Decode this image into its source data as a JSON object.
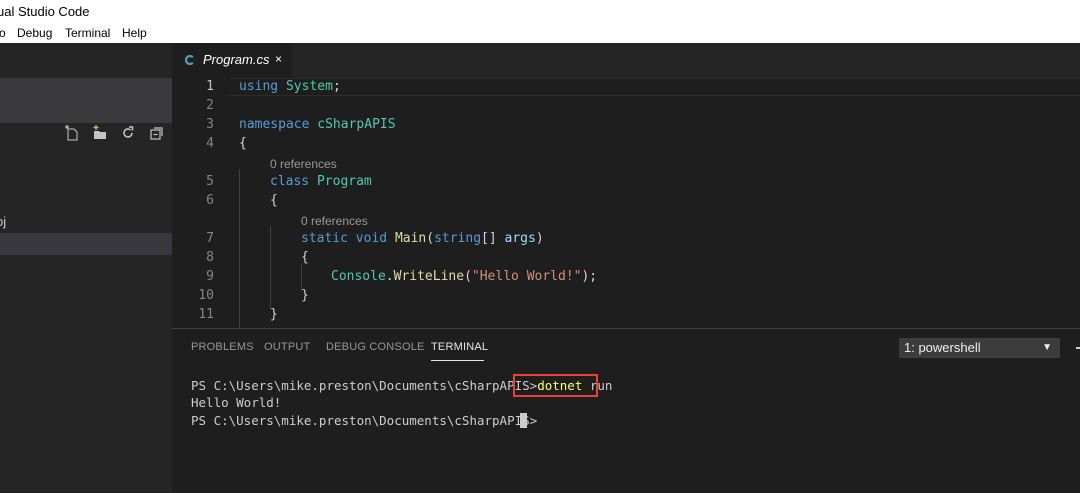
{
  "window": {
    "title": "ual Studio Code"
  },
  "menu": {
    "items": [
      "o",
      "Debug",
      "Terminal",
      "Help"
    ]
  },
  "sidebar": {
    "items": [
      "oj"
    ]
  },
  "tab": {
    "label": "Program.cs",
    "close": "×"
  },
  "editor": {
    "line_numbers": [
      "1",
      "2",
      "3",
      "4",
      "5",
      "6",
      "7",
      "8",
      "9",
      "10",
      "11"
    ],
    "lens": "0 references",
    "tokens": {
      "using": "using",
      "system": "System",
      "semi": ";",
      "namespace": "namespace",
      "ns_name": "cSharpAPIS",
      "open_brace": "{",
      "close_brace": "}",
      "class_kw": "class",
      "class_name": "Program",
      "static_kw": "static",
      "void_kw": "void",
      "main": "Main",
      "paren_open": "(",
      "string_kw": "string",
      "brackets": "[] ",
      "args": "args",
      "paren_close": ")",
      "console": "Console",
      "dot": ".",
      "writeline": "WriteLine",
      "str": "\"Hello World!\"",
      "call_end": ");"
    }
  },
  "panel": {
    "tabs": [
      "PROBLEMS",
      "OUTPUT",
      "DEBUG CONSOLE",
      "TERMINAL"
    ],
    "active_tab": "TERMINAL",
    "terminal_select": "1: powershell",
    "select_arrow": "▼"
  },
  "terminal": {
    "prompt": "PS C:\\Users\\mike.preston\\Documents\\cSharpAPIS>",
    "cmd": "dotnet",
    "cmd_arg": " run",
    "output": "Hello World!"
  },
  "colors": {
    "highlight_box": "#e8413a",
    "accent_csharp": "#519aba"
  }
}
